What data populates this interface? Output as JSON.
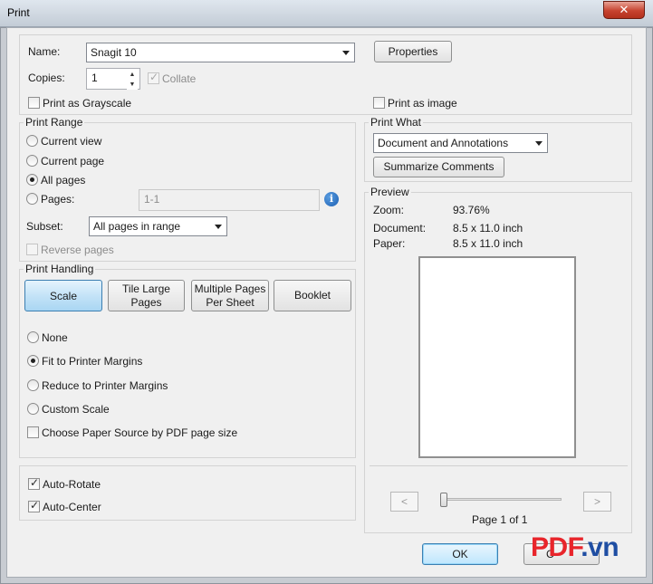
{
  "window": {
    "title": "Print",
    "close_glyph": "✕"
  },
  "printer": {
    "name_label": "Name:",
    "name_value": "Snagit 10",
    "properties_button": "Properties",
    "copies_label": "Copies:",
    "copies_value": "1",
    "collate_label": "Collate",
    "grayscale_label": "Print as Grayscale",
    "print_as_image_label": "Print as image"
  },
  "print_range": {
    "title": "Print Range",
    "current_view": "Current view",
    "current_page": "Current page",
    "all_pages": "All pages",
    "pages_label": "Pages:",
    "pages_value": "1-1",
    "subset_label": "Subset:",
    "subset_value": "All pages in range",
    "reverse_pages": "Reverse pages"
  },
  "print_handling": {
    "title": "Print Handling",
    "scale": "Scale",
    "tile_large_pages": "Tile Large Pages",
    "multiple_pages_per_sheet": "Multiple Pages Per Sheet",
    "booklet": "Booklet",
    "none": "None",
    "fit_to_printer_margins": "Fit to Printer Margins",
    "reduce_to_printer_margins": "Reduce to Printer Margins",
    "custom_scale": "Custom Scale",
    "choose_paper_source": "Choose Paper Source by PDF page size",
    "auto_rotate": "Auto-Rotate",
    "auto_center": "Auto-Center"
  },
  "print_what": {
    "title": "Print What",
    "value": "Document and Annotations",
    "summarize_button": "Summarize Comments"
  },
  "preview": {
    "title": "Preview",
    "zoom_label": "Zoom:",
    "zoom_value": "93.76%",
    "document_label": "Document:",
    "document_value": "8.5 x 11.0 inch",
    "paper_label": "Paper:",
    "paper_value": "8.5 x 11.0 inch",
    "prev_glyph": "<",
    "next_glyph": ">",
    "page_indicator": "Page 1 of 1"
  },
  "footer": {
    "ok_button": "OK",
    "cancel_button_visible": "C"
  },
  "watermark": {
    "part1": "PDF",
    "part2": ".vn"
  },
  "colors": {
    "accent": "#3c7fb1",
    "watermark_red": "#e8252b",
    "watermark_blue": "#1f4ea3"
  },
  "icons": {
    "info": "info-icon",
    "close": "close-icon",
    "dropdown": "chevron-down-icon"
  }
}
